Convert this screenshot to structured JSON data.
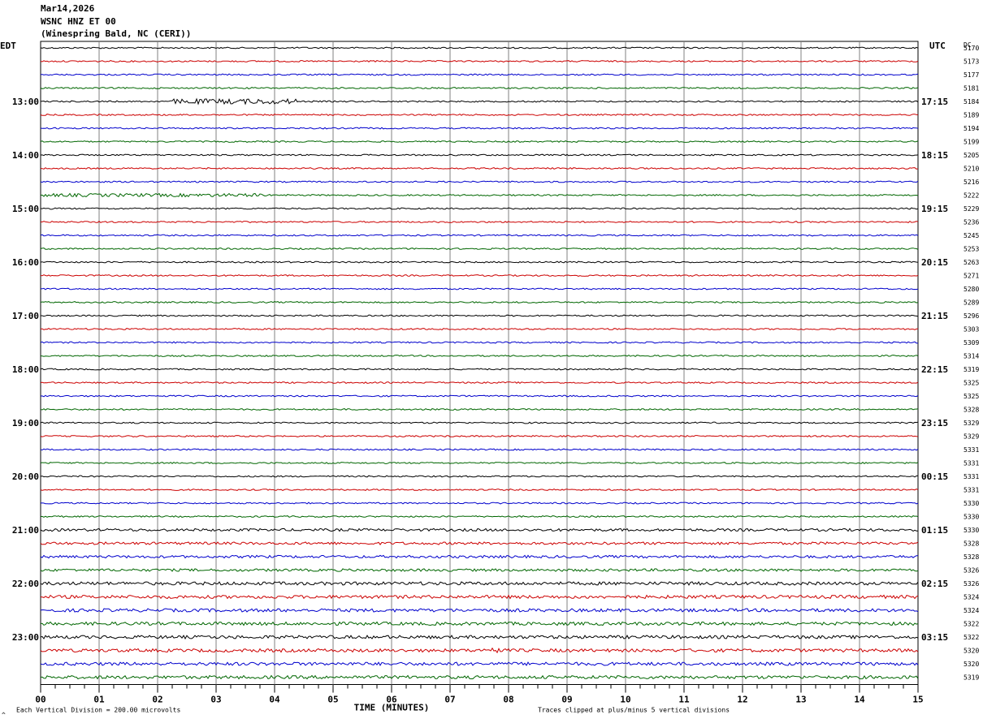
{
  "header": {
    "date": "Mar14,2026",
    "station": "WSNC HNZ ET 00",
    "location": "(Winespring Bald, NC (CERI))"
  },
  "chart_data": {
    "type": "line",
    "title": "",
    "left_axis_label": "EDT",
    "right_axis_label": "UTC",
    "dc_label": "DC",
    "xlabel": "TIME (MINUTES)",
    "x_ticks": [
      "00",
      "01",
      "02",
      "03",
      "04",
      "05",
      "06",
      "07",
      "08",
      "09",
      "10",
      "11",
      "12",
      "13",
      "14",
      "15"
    ],
    "xlim": [
      0,
      15
    ],
    "left_hour_labels": [
      "13:00",
      "14:00",
      "15:00",
      "16:00",
      "17:00",
      "18:00",
      "19:00",
      "20:00",
      "21:00",
      "22:00",
      "23:00"
    ],
    "right_hour_labels": [
      "17:15",
      "18:15",
      "19:15",
      "20:15",
      "21:15",
      "22:15",
      "23:15",
      "00:15",
      "01:15",
      "02:15",
      "03:15"
    ],
    "dc_offsets": [
      "5170",
      "5173",
      "5177",
      "5181",
      "5184",
      "5189",
      "5194",
      "5199",
      "5205",
      "5210",
      "5216",
      "5222",
      "5229",
      "5236",
      "5245",
      "5253",
      "5263",
      "5271",
      "5280",
      "5289",
      "5296",
      "5303",
      "5309",
      "5314",
      "5319",
      "5325",
      "5325",
      "5328",
      "5329",
      "5329",
      "5331",
      "5331",
      "5331",
      "5331",
      "5330",
      "5330",
      "5330",
      "5328",
      "5328",
      "5326",
      "5326",
      "5324",
      "5324",
      "5322",
      "5322",
      "5320",
      "5320",
      "5319"
    ],
    "trace_colors": [
      "#000000",
      "#cc0000",
      "#0000cc",
      "#006600"
    ],
    "grid_color": "#808080",
    "footer_left": "Each Vertical Division =  200.00 microvolts",
    "footer_right": "Traces clipped at plus/minus 5 vertical divisions",
    "corner_mark": "^"
  }
}
